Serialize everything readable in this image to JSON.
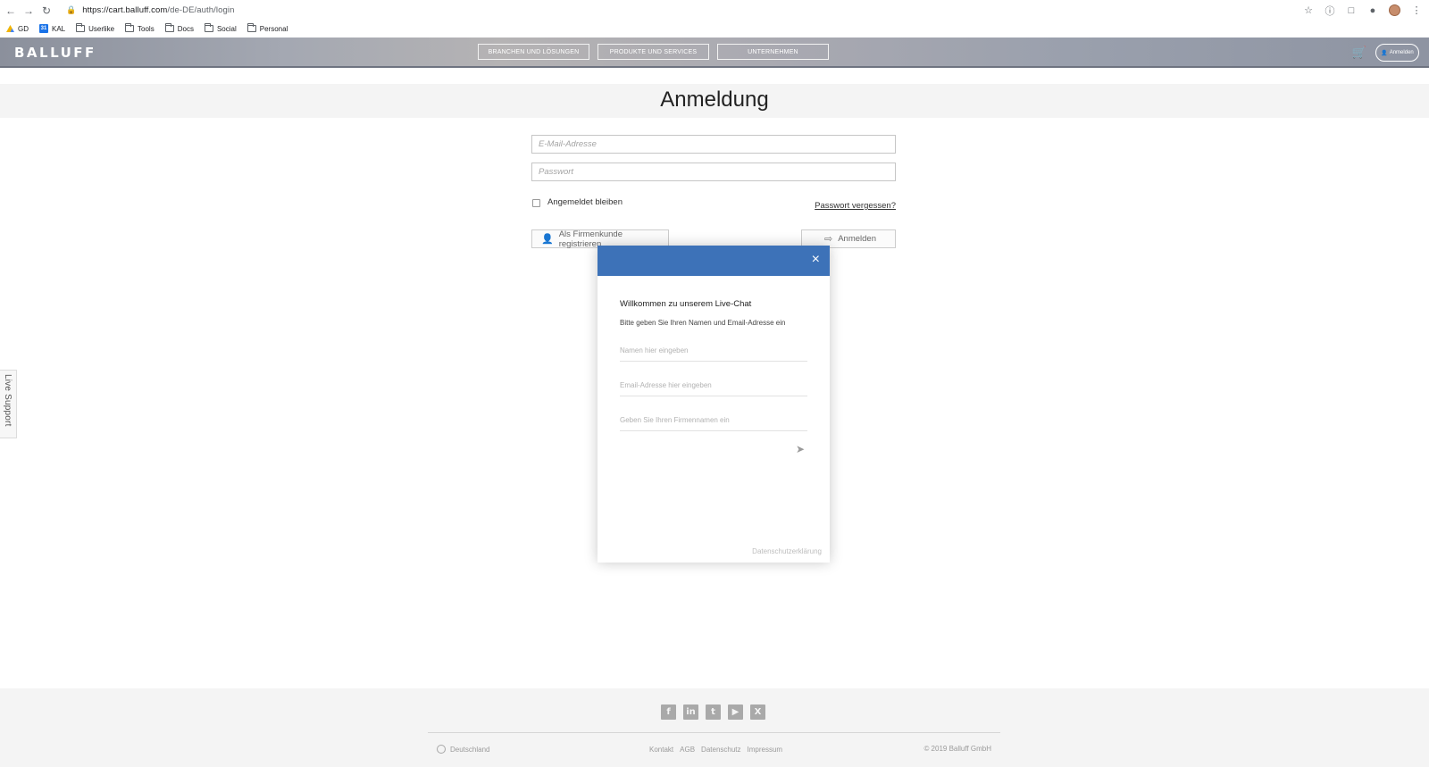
{
  "browser": {
    "url_host": "https://cart.balluff.com",
    "url_path": "/de-DE/auth/login",
    "bookmarks": [
      "GD",
      "KAL",
      "Userlike",
      "Tools",
      "Docs",
      "Social",
      "Personal"
    ]
  },
  "header": {
    "logo": "BALLUFF",
    "nav": [
      "BRANCHEN UND LÖSUNGEN",
      "PRODUKTE UND SERVICES",
      "UNTERNEHMEN"
    ],
    "login_label": "Anmelden"
  },
  "page": {
    "title": "Anmeldung"
  },
  "form": {
    "email_placeholder": "E-Mail-Adresse",
    "password_placeholder": "Passwort",
    "remember_label": "Angemeldet bleiben",
    "forgot_label": "Passwort vergessen?",
    "register_label": "Als Firmenkunde registrieren",
    "signin_label": "Anmelden"
  },
  "live_support": {
    "label": "Live Support"
  },
  "chat": {
    "title": "Willkommen zu unserem Live-Chat",
    "subtitle": "Bitte geben Sie Ihren Namen und Email-Adresse ein",
    "name_placeholder": "Namen hier eingeben",
    "email_placeholder": "Email-Adresse hier eingeben",
    "company_placeholder": "Geben Sie Ihren Firmennamen ein",
    "privacy_label": "Datenschutzerklärung",
    "close_symbol": "×",
    "header_color": "#3d72b8"
  },
  "footer": {
    "socials": [
      "f",
      "in",
      "t",
      "yt",
      "x"
    ],
    "country": "Deutschland",
    "links": [
      "Kontakt",
      "AGB",
      "Datenschutz",
      "Impressum"
    ],
    "copyright": "© 2019 Balluff GmbH"
  }
}
